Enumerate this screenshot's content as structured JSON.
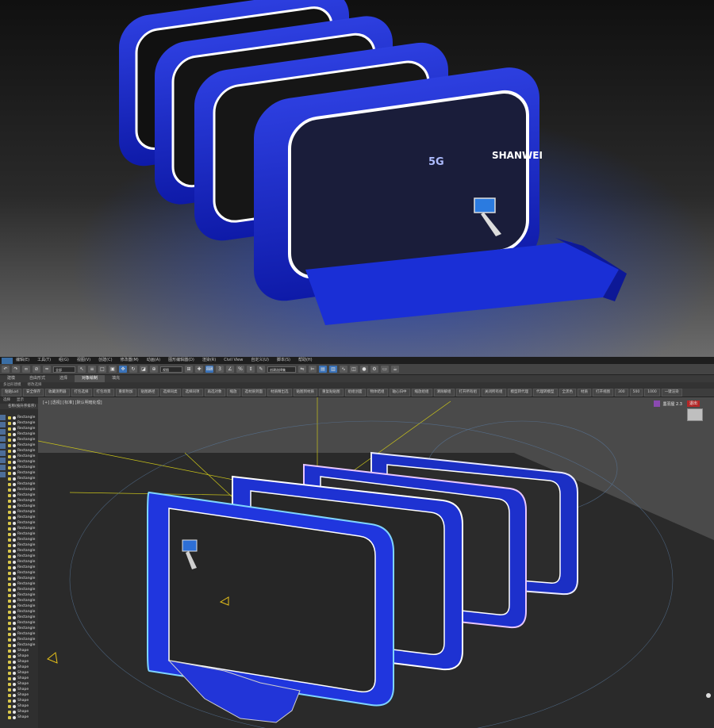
{
  "render": {
    "booth_text": "SHANWEI",
    "badge_5g": "5G"
  },
  "menubar": {
    "items": [
      "编辑(E)",
      "工具(T)",
      "组(G)",
      "视图(V)",
      "创建(C)",
      "修改器(M)",
      "动画(A)",
      "图形编辑器(D)",
      "渲染(R)",
      "Civil View",
      "自定义(U)",
      "脚本(S)",
      "帮助(H)"
    ]
  },
  "toolbar": {
    "selection_filter": "全部",
    "view_dropdown": "视图",
    "selection_set": "创建选择集"
  },
  "ribbon": {
    "tabs": [
      "建模",
      "自由形式",
      "选择",
      "对象绘制",
      "填充"
    ],
    "active_tab": "对象绘制",
    "sub": [
      "多边形建模",
      "修改选择"
    ]
  },
  "cmd_strip": {
    "items": [
      "粘贴Lod",
      "安全保存",
      "收藏测用器",
      "打包选择",
      "打包场景",
      "重新附加",
      "贴图路径",
      "选择同类",
      "选择同项",
      "再选对象",
      "缩放",
      "选材质到面",
      "材质精出选",
      "贴图到材质",
      "重复贴贴图",
      "组组创面",
      "物体结组",
      "轴心归中",
      "缩放组组",
      "清除解组",
      "打开所有组",
      "关闭所有组",
      "模型转代理",
      "代理转模型",
      "全黑色",
      "材质",
      "打开视图",
      "300",
      "500",
      "1000",
      "一键渲染"
    ]
  },
  "explorer": {
    "tabs": [
      "选择",
      "显示"
    ],
    "header": "名称(按升序排序)",
    "rows": [
      "Rectangle",
      "Rectangle",
      "Rectangle",
      "Rectangle",
      "Rectangle",
      "Rectangle",
      "Rectangle",
      "Rectangle",
      "Rectangle",
      "Rectangle",
      "Rectangle",
      "Rectangle",
      "Rectangle",
      "Rectangle",
      "Rectangle",
      "Rectangle",
      "Rectangle",
      "Rectangle",
      "Rectangle",
      "Rectangle",
      "Rectangle",
      "Rectangle",
      "Rectangle",
      "Rectangle",
      "Rectangle",
      "Rectangle",
      "Rectangle",
      "Rectangle",
      "Rectangle",
      "Rectangle",
      "Rectangle",
      "Rectangle",
      "Rectangle",
      "Rectangle",
      "Rectangle",
      "Rectangle",
      "Rectangle",
      "Rectangle",
      "Rectangle",
      "Rectangle",
      "Rectangle",
      "Rectangle",
      "Shape",
      "Shape",
      "Shape",
      "Shape",
      "Shape",
      "Shape",
      "Shape",
      "Shape",
      "Shape",
      "Shape",
      "Shape",
      "Shape",
      "Shape"
    ]
  },
  "viewport": {
    "label": "[+] [透视] [标准] [默认明暗处理]",
    "plugin_name": "墨羽屋 2.3",
    "plugin_button": "退出"
  }
}
